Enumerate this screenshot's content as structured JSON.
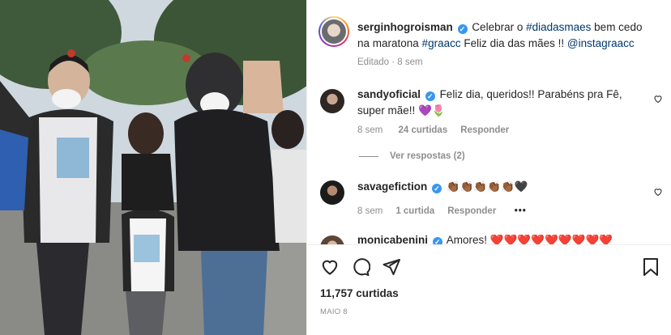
{
  "post": {
    "author": "serginhogroisman",
    "caption_parts": {
      "t1": "Celebrar o ",
      "tag1": "#diadasmaes",
      "t2": " bem cedo na maratona ",
      "tag2": "#graacc",
      "t3": " Feliz dia das mães !! ",
      "mention": "@instagraacc"
    },
    "edited": "Editado",
    "age": "8 sem",
    "likes": "11,757 curtidas",
    "date": "MAIO 8"
  },
  "comments": [
    {
      "user": "sandyoficial",
      "text": "Feliz dia, queridos!! Parabéns pra Fê, super mãe!! 💜🌷",
      "age": "8 sem",
      "likes": "24 curtidas",
      "reply": "Responder",
      "view_replies": "Ver respostas (2)"
    },
    {
      "user": "savagefiction",
      "text": "👏🏾👏🏾👏🏾👏🏾👏🏾🖤",
      "age": "8 sem",
      "likes": "1 curtida",
      "reply": "Responder",
      "more": "•••"
    },
    {
      "user": "monicabenini",
      "text": "Amores! ❤️❤️❤️❤️❤️❤️❤️❤️❤️"
    }
  ],
  "icons": {
    "verified": "verified-badge-icon",
    "heart": "heart-icon",
    "comment": "comment-icon",
    "share": "share-icon",
    "bookmark": "bookmark-icon"
  },
  "colors": {
    "verified": "#3897f0",
    "link": "#00376b",
    "muted": "#8e8e8e"
  }
}
